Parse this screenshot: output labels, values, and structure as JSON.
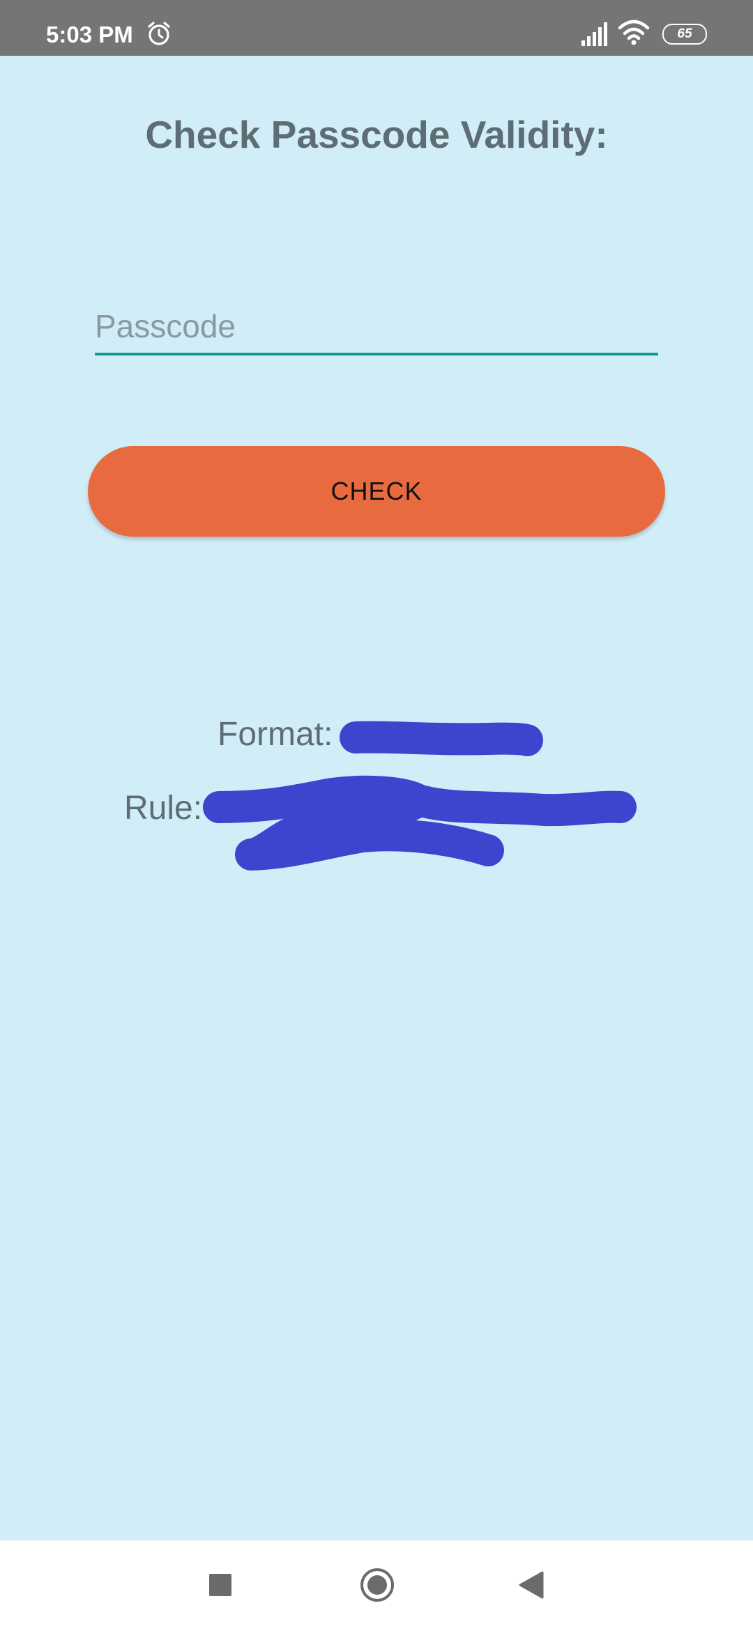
{
  "status_bar": {
    "time": "5:03 PM",
    "battery_level": "65",
    "icons": [
      "alarm-icon",
      "signal-icon",
      "wifi-icon",
      "battery-icon"
    ]
  },
  "main": {
    "title": "Check Passcode Validity:",
    "passcode_input": {
      "placeholder": "Passcode",
      "value": ""
    },
    "check_button_label": "CHECK",
    "format_label": "Format:",
    "rule_label": "Rule:"
  },
  "nav_bar": {
    "icons": [
      "recents-icon",
      "home-icon",
      "back-icon"
    ]
  },
  "colors": {
    "background": "#d0edf8",
    "status_bar": "#757575",
    "accent_underline": "#129b8d",
    "button": "#e76b3e",
    "redaction": "#3d45cf",
    "text": "#5e6c73"
  }
}
